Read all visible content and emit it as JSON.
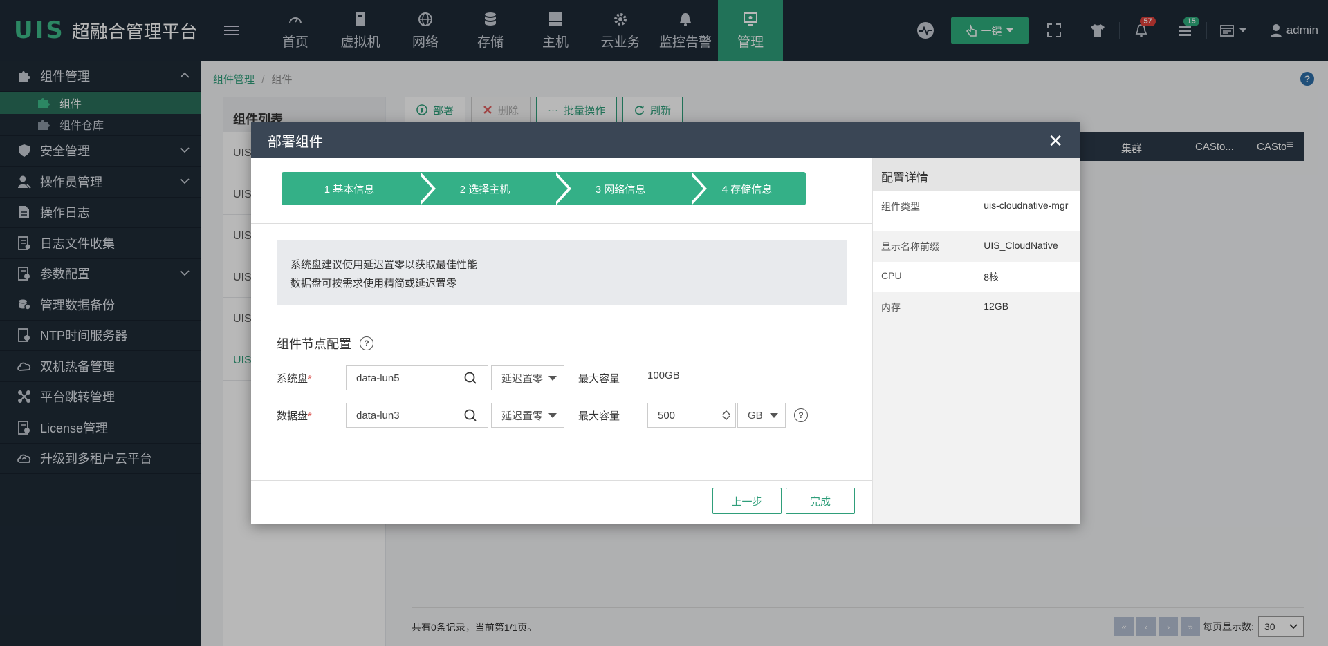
{
  "app": {
    "brand": "UIS",
    "title": "超融合管理平台"
  },
  "nav": [
    {
      "label": "首页",
      "icon": "dashboard-icon"
    },
    {
      "label": "虚拟机",
      "icon": "vm-icon"
    },
    {
      "label": "网络",
      "icon": "globe-icon"
    },
    {
      "label": "存储",
      "icon": "database-icon"
    },
    {
      "label": "主机",
      "icon": "server-icon"
    },
    {
      "label": "云业务",
      "icon": "gear-icon"
    },
    {
      "label": "监控告警",
      "icon": "bell-icon"
    },
    {
      "label": "管理",
      "icon": "monitor-icon"
    }
  ],
  "topright": {
    "yijian": "一键",
    "notif_count": "57",
    "task_count": "15",
    "user": "admin"
  },
  "sidebar": {
    "items": [
      {
        "label": "组件管理"
      },
      {
        "label": "安全管理"
      },
      {
        "label": "操作员管理"
      },
      {
        "label": "操作日志"
      },
      {
        "label": "日志文件收集"
      },
      {
        "label": "参数配置"
      },
      {
        "label": "管理数据备份"
      },
      {
        "label": "NTP时间服务器"
      },
      {
        "label": "双机热备管理"
      },
      {
        "label": "平台跳转管理"
      },
      {
        "label": "License管理"
      },
      {
        "label": "升级到多租户云平台"
      }
    ],
    "subitems": [
      {
        "label": "组件"
      },
      {
        "label": "组件仓库"
      }
    ]
  },
  "breadcrumb": {
    "root": "组件管理",
    "sep": "/",
    "current": "组件"
  },
  "listpanel": {
    "title": "组件列表",
    "rows": [
      "UIS",
      "UIS",
      "UIS",
      "UIS",
      "UIS",
      "UIS"
    ]
  },
  "toolbar": {
    "deploy": "部署",
    "delete": "删除",
    "batch": "批量操作",
    "refresh": "刷新"
  },
  "table": {
    "columns": [
      "集群",
      "CASto...",
      "CASto"
    ]
  },
  "footer": {
    "records": "共有0条记录，当前第1/1页。",
    "per_page_label": "每页显示数:",
    "per_page": "30"
  },
  "modal": {
    "title": "部署组件",
    "close": "✕",
    "steps": [
      "1 基本信息",
      "2 选择主机",
      "3 网络信息",
      "4 存储信息"
    ],
    "info_lines": [
      "系统盘建议使用延迟置零以获取最佳性能",
      "数据盘可按需求使用精简或延迟置零"
    ],
    "section_title": "组件节点配置",
    "sysdisk": {
      "label": "系统盘",
      "required": "*",
      "value": "data-lun5",
      "mode": "延迟置零",
      "cap_label": "最大容量",
      "cap_value": "100GB"
    },
    "datadisk": {
      "label": "数据盘",
      "required": "*",
      "value": "data-lun3",
      "mode": "延迟置零",
      "cap_label": "最大容量",
      "cap_value": "500",
      "unit": "GB"
    },
    "prev": "上一步",
    "finish": "完成",
    "detail": {
      "title": "配置详情",
      "rows": [
        {
          "k": "组件类型",
          "v": "uis-cloudnative-mgr"
        },
        {
          "k": "显示名称前缀",
          "v": "UIS_CloudNative"
        },
        {
          "k": "CPU",
          "v": "8核"
        },
        {
          "k": "内存",
          "v": "12GB"
        }
      ]
    }
  },
  "colors": {
    "accent": "#2f9e7a",
    "topbar": "#1e2a36",
    "sidebar": "#1f2b37",
    "modal_head": "#3a4655"
  }
}
